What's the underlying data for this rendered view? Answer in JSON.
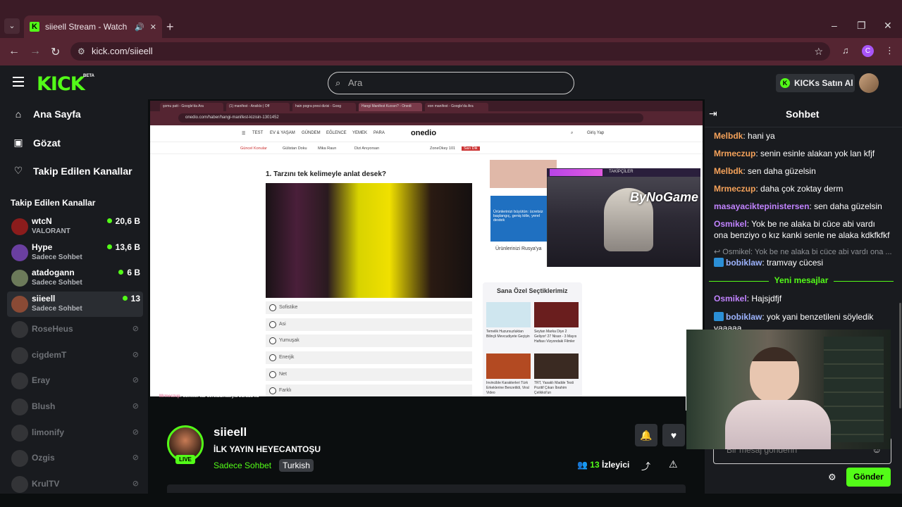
{
  "browser": {
    "tab_title": "siieell Stream - Watch Live o",
    "url": "kick.com/siieell",
    "profile_letter": "C"
  },
  "header": {
    "logo": "KICK",
    "beta": "BETA",
    "search_placeholder": "Ara",
    "buy_kicks": "KICKs Satın Al"
  },
  "sidebar": {
    "nav": [
      {
        "label": "Ana Sayfa",
        "icon": "home-icon"
      },
      {
        "label": "Gözat",
        "icon": "browse-icon"
      },
      {
        "label": "Takip Edilen Kanallar",
        "icon": "heart-icon"
      }
    ],
    "followed_title": "Takip Edilen Kanallar",
    "live_channels": [
      {
        "name": "wtcN",
        "sub": "VALORANT",
        "viewers": "20,6 B"
      },
      {
        "name": "Hype",
        "sub": "Sadece Sohbet",
        "viewers": "13,6 B"
      },
      {
        "name": "atadogann",
        "sub": "Sadece Sohbet",
        "viewers": "6 B"
      },
      {
        "name": "siieell",
        "sub": "Sadece Sohbet",
        "viewers": "13"
      }
    ],
    "offline_channels": [
      "RoseHeus",
      "cigdemT",
      "Eray",
      "Blush",
      "limonify",
      "Ozgis",
      "KrulTV"
    ]
  },
  "video": {
    "tabs": [
      "şomu patt - Google'da Ara",
      "(1) manifest - Ansiklo | Off",
      "hain pogra presi dizisi - Goog",
      "Hangi Manifest Kızısın? - Onedi",
      "eon manifest - Google'da Ara"
    ],
    "inner_url": "onedio.com/haber/hangi-manifest-kizisin-1301452",
    "site_nav": [
      "TEST",
      "EV & YAŞAM",
      "GÜNDEM",
      "EĞLENCE",
      "YEMEK",
      "PARA"
    ],
    "site_logo": "onedio",
    "site_login": "Giriş Yap",
    "trending": [
      "Güncel Konular",
      "Gülistan Doku",
      "Mika Raun",
      "Dizi Anıyorsan",
      "ZoneOkey 101",
      "Sarı Dik"
    ],
    "question": "1. Tarzını tek kelimeyle anlat desek?",
    "options": [
      "Sofistike",
      "Asi",
      "Yumuşak",
      "Enerjik",
      "Net",
      "Farklı"
    ],
    "ad_text": "Ürünlerinizi Rusya'ya",
    "ad_blue": "Ürünlerinizi büyütün: ücretsiz başlangıç, geniş kitle, yerel destek",
    "follower_label": "TAKİPÇİLER",
    "watermark": "ByNoGame",
    "picks_title": "Sana Özel Seçtiklerimiz",
    "picks": [
      "Temelik Huzursuzluktan Bilinçli Mevcudiyete Geçişin",
      "Seytan Marka Diye 2 Geliyor! 27 Nisan - 3 Mayıs Haftası Vizyondaki Filmler",
      "Invincible Karakterleri Türk Erkeklerine Benzetildi, Viral Video",
      "TRT, Yasaklı Madde Testi Pozitif Çıkan İbrahim Çelikkol'un"
    ],
    "caption_user": "Mrmeczup",
    "caption_text": ": osmikel sar zorbalamasıyla burada xd"
  },
  "stream": {
    "name": "siieell",
    "live": "LIVE",
    "title": "İLK YAYIN HEYECANTOŞU",
    "category": "Sadece Sohbet",
    "tag": "Turkish",
    "viewers": "13",
    "viewers_label": "İzleyici"
  },
  "chat": {
    "title": "Sohbet",
    "messages": [
      {
        "user": "Melbdk",
        "color": "#f5a25a",
        "text": "hani ya"
      },
      {
        "user": "Mrmeczup",
        "color": "#f5a25a",
        "text": "senin esinle alakan yok lan kfjf"
      },
      {
        "user": "Melbdk",
        "color": "#f5a25a",
        "text": "sen daha güzelsin"
      },
      {
        "user": "Mrmeczup",
        "color": "#f5a25a",
        "text": "daha çok zoktay derm"
      },
      {
        "user": "masayaciktepinistersen",
        "color": "#c183ff",
        "text": "sen daha güzelsin"
      },
      {
        "user": "Osmikel",
        "color": "#c183ff",
        "text": "Yok be ne alaka bi cüce abi vardı ona benziyo o kız kanki senle ne alaka kdkfkfkf"
      }
    ],
    "reply_preview": "Osmikel: Yok be ne alaka bi cüce abi vardı ona ...",
    "after_reply": {
      "user": "bobiklaw",
      "text": "tramvay cücesi"
    },
    "new_messages": "Yeni mesajlar",
    "new": [
      {
        "user": "Osmikel",
        "text": "Hajsjdfjf"
      },
      {
        "user": "bobiklaw",
        "text": "yok yani benzetileni söyledik yaaaaa"
      }
    ],
    "input_placeholder": "Bir mesaj gönderin",
    "send": "Gönder"
  }
}
